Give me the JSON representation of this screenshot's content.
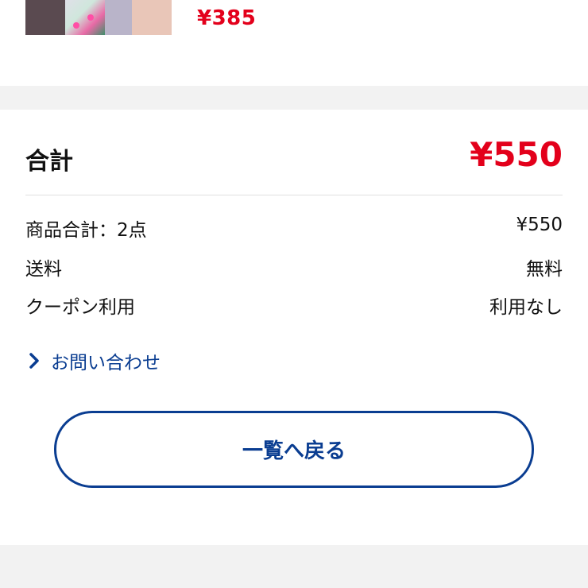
{
  "item": {
    "price": "¥385"
  },
  "summary": {
    "total_label": "合計",
    "total_value": "¥550",
    "rows": [
      {
        "label": "商品合計：2点",
        "value": "¥550"
      },
      {
        "label": "送料",
        "value": "無料"
      },
      {
        "label": "クーポン利用",
        "value": "利用なし"
      }
    ]
  },
  "contact": {
    "label": "お問い合わせ",
    "icon": "chevron-right-icon"
  },
  "actions": {
    "back_label": "一覧へ戻る"
  },
  "colors": {
    "price_red": "#e3001b",
    "link_blue": "#0a3d91",
    "separator_gray": "#f2f2f2"
  }
}
